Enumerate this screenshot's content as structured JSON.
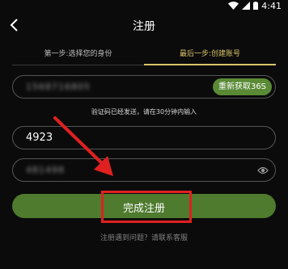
{
  "status": {
    "time": "4:41"
  },
  "header": {
    "title": "注册"
  },
  "steps": [
    {
      "label": "第一步:选择您的身份"
    },
    {
      "label": "最后一步:创建账号"
    }
  ],
  "phone_field": {
    "value": "1568716805",
    "resend_label": "重新获取36S"
  },
  "hint": "验证码已经发送，请在30分钟内输入",
  "code_field": {
    "value": "4923"
  },
  "password_field": {
    "value": "481498"
  },
  "submit": {
    "label": "完成注册"
  },
  "help": "注册遇到问题？请联系客服",
  "colors": {
    "background": "#0b0b0b",
    "accent_green": "#4e7b2e",
    "step_active": "#d9c46a",
    "annotation_red": "#e02020"
  },
  "icons": [
    "wifi-icon",
    "signal-icon",
    "battery-icon",
    "back-arrow-icon",
    "eye-icon"
  ]
}
